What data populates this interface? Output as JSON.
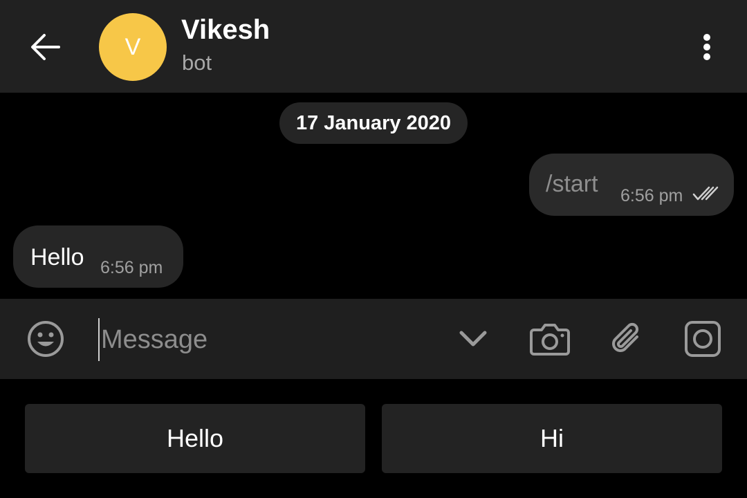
{
  "header": {
    "back_icon": "arrow-left-icon",
    "avatar_letter": "V",
    "avatar_color": "#F7C748",
    "name": "Vikesh",
    "status": "bot",
    "menu_icon": "more-vertical-icon"
  },
  "messages": {
    "date": "17 January 2020",
    "outgoing": {
      "text": "/start",
      "time": "6:56 pm",
      "status_icon": "double-check-icon"
    },
    "incoming": {
      "text": "Hello",
      "time": "6:56 pm"
    }
  },
  "input_bar": {
    "emoji_icon": "emoji-icon",
    "placeholder": "Message",
    "value": "",
    "icons": [
      "chevron-down-icon",
      "camera-icon",
      "paperclip-icon",
      "record-icon"
    ]
  },
  "bot_keyboard": {
    "buttons": [
      "Hello",
      "Hi"
    ]
  },
  "colors": {
    "background": "#000000",
    "header": "#212121",
    "accent_avatar": "#F7C748"
  }
}
